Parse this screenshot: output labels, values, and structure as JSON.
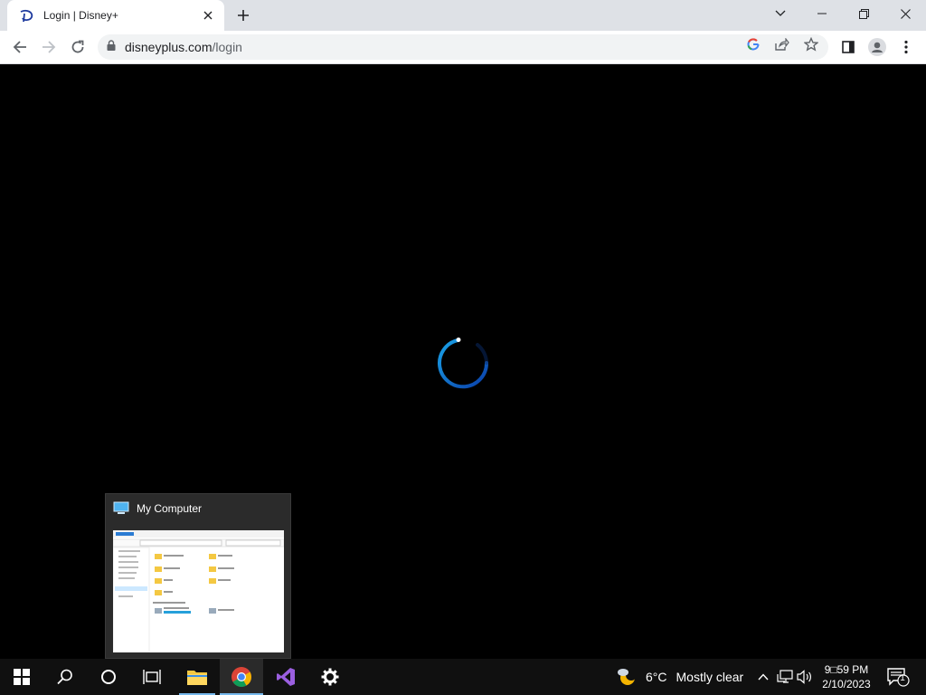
{
  "browser": {
    "tab": {
      "title": "Login | Disney+"
    },
    "address": {
      "domain": "disneyplus.com",
      "path": "/login"
    }
  },
  "page": {
    "status": "loading"
  },
  "taskbar_preview": {
    "title": "My Computer"
  },
  "taskbar": {
    "weather": {
      "temp": "6°C",
      "condition": "Mostly clear"
    },
    "clock": {
      "time": "9□59 PM",
      "date": "2/10/2023"
    },
    "notifications": "1"
  },
  "colors": {
    "accent": "#76b9ed",
    "spinner": "#1aa3e8"
  }
}
